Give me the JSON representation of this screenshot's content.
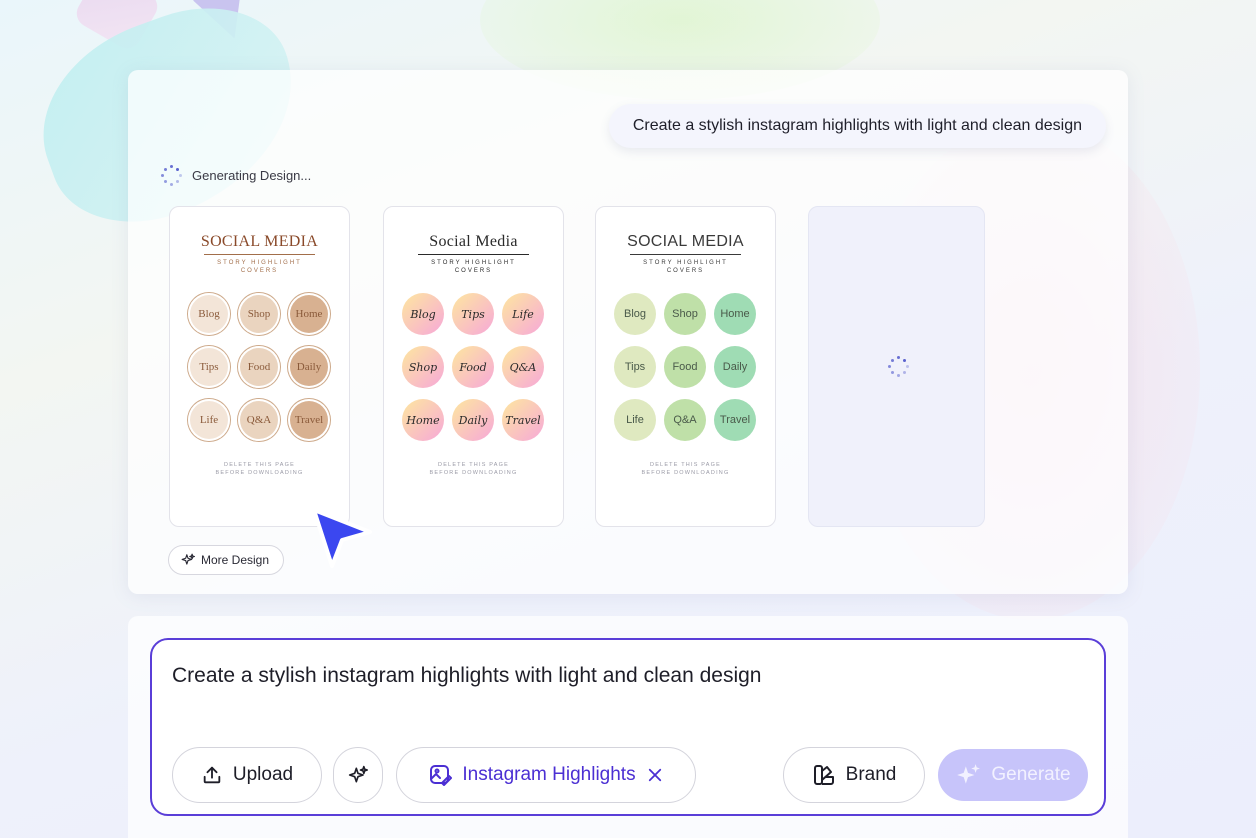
{
  "prompt_bubble": "Create a stylish instagram highlights with light and clean design",
  "status_text": "Generating Design...",
  "cards": [
    {
      "title": "SOCIAL MEDIA",
      "subtitle_line1": "STORY HIGHLIGHT",
      "subtitle_line2": "COVERS",
      "labels": [
        "Blog",
        "Shop",
        "Home",
        "Tips",
        "Food",
        "Daily",
        "Life",
        "Q&A",
        "Travel"
      ],
      "footer_line1": "DELETE THIS PAGE",
      "footer_line2": "BEFORE DOWNLOADING",
      "title_color": "#8a4a2a"
    },
    {
      "title": "Social Media",
      "subtitle_line1": "STORY HIGHLIGHT",
      "subtitle_line2": "COVERS",
      "labels": [
        "Blog",
        "Tips",
        "Life",
        "Shop",
        "Food",
        "Q&A",
        "Home",
        "Daily",
        "Travel"
      ],
      "footer_line1": "DELETE THIS PAGE",
      "footer_line2": "BEFORE DOWNLOADING",
      "title_color": "#2a2a2a"
    },
    {
      "title": "SOCIAL MEDIA",
      "subtitle_line1": "STORY HIGHLIGHT",
      "subtitle_line2": "COVERS",
      "labels": [
        "Blog",
        "Shop",
        "Home",
        "Tips",
        "Food",
        "Daily",
        "Life",
        "Q&A",
        "Travel"
      ],
      "footer_line1": "DELETE THIS PAGE",
      "footer_line2": "BEFORE DOWNLOADING",
      "title_color": "#3a3a3a"
    }
  ],
  "more_design_label": "More Design",
  "input": {
    "value": "Create a stylish instagram highlights with light and clean design"
  },
  "toolbar": {
    "upload_label": "Upload",
    "template_chip_label": "Instagram Highlights",
    "brand_label": "Brand",
    "generate_label": "Generate"
  },
  "colors": {
    "accent": "#4b2fd3",
    "input_border": "#5a3ed8",
    "generate_bg": "#c7c4fa",
    "cursor": "#3b47f0"
  }
}
